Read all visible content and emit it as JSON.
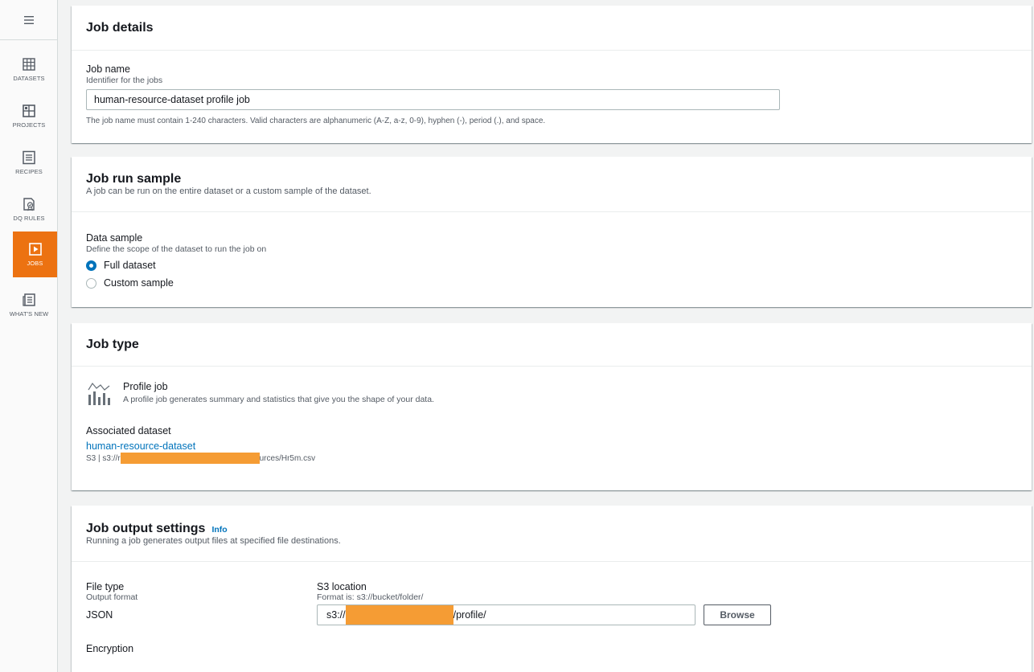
{
  "sidebar": {
    "menu_icon": "hamburger-icon",
    "items": [
      {
        "label": "DATASETS",
        "icon": "table-icon",
        "active": false
      },
      {
        "label": "PROJECTS",
        "icon": "grid-icon",
        "active": false
      },
      {
        "label": "RECIPES",
        "icon": "list-icon",
        "active": false
      },
      {
        "label": "DQ RULES",
        "icon": "rules-icon",
        "active": false
      },
      {
        "label": "JOBS",
        "icon": "play-icon",
        "active": true
      },
      {
        "label": "WHAT'S NEW",
        "icon": "news-icon",
        "active": false
      }
    ],
    "active_color": "#ec7211"
  },
  "job_details": {
    "title": "Job details",
    "job_name_label": "Job name",
    "job_name_desc": "Identifier for the jobs",
    "job_name_value": "human-resource-dataset profile job",
    "job_name_hint": "The job name must contain 1-240 characters. Valid characters are alphanumeric (A-Z, a-z, 0-9), hyphen (-), period (.), and space."
  },
  "job_run_sample": {
    "title": "Job run sample",
    "desc": "A job can be run on the entire dataset or a custom sample of the dataset.",
    "data_sample_label": "Data sample",
    "data_sample_desc": "Define the scope of the dataset to run the job on",
    "options": [
      {
        "label": "Full dataset",
        "checked": true
      },
      {
        "label": "Custom sample",
        "checked": false
      }
    ]
  },
  "job_type": {
    "title": "Job type",
    "type_icon": "profile-chart-icon",
    "type_label": "Profile job",
    "type_desc": "A profile job generates summary and statistics that give you the shape of your data.",
    "assoc_label": "Associated dataset",
    "dataset_link": "human-resource-dataset",
    "dataset_path_prefix": "S3 | s3://r",
    "dataset_path_suffix": "urces/Hr5m.csv"
  },
  "job_output": {
    "title": "Job output settings",
    "info_link": "Info",
    "desc": "Running a job generates output files at specified file destinations.",
    "file_type_label": "File type",
    "file_type_desc": "Output format",
    "file_type_value": "JSON",
    "s3_label": "S3 location",
    "s3_desc": "Format is: s3://bucket/folder/",
    "s3_prefix": "s3://",
    "s3_suffix": "/profile/",
    "browse_label": "Browse",
    "encryption_label": "Encryption"
  }
}
